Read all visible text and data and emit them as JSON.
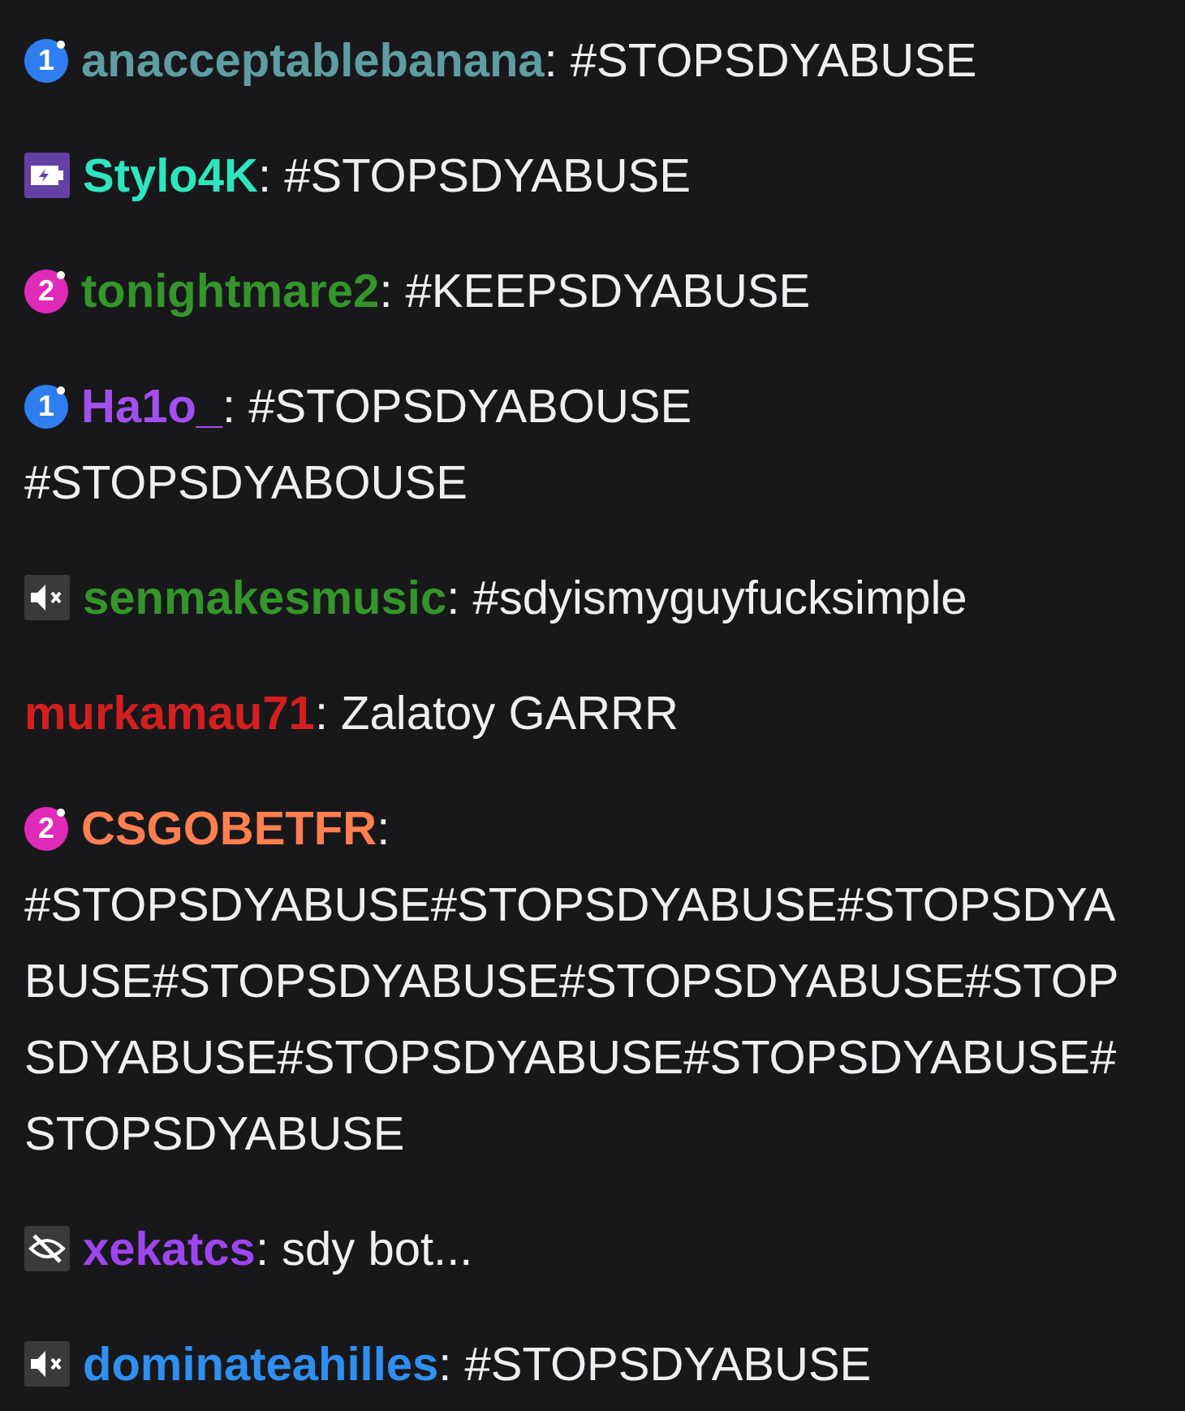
{
  "messages": [
    {
      "badge": {
        "kind": "sub",
        "text": "1",
        "color": "#2f7ef0"
      },
      "user": {
        "name": "anacceptablebanana",
        "color": "#5f9ea0"
      },
      "text": ": #STOPSDYABUSE"
    },
    {
      "badge": {
        "kind": "battery"
      },
      "user": {
        "name": "Stylo4K",
        "color": "#2ee6bd"
      },
      "text": ": #STOPSDYABUSE"
    },
    {
      "badge": {
        "kind": "sub",
        "text": "2",
        "color": "#e02ab8"
      },
      "user": {
        "name": "tonightmare2",
        "color": "#34952a"
      },
      "text": ": #KEEPSDYABUSE"
    },
    {
      "badge": {
        "kind": "sub",
        "text": "1",
        "color": "#2f7ef0"
      },
      "user": {
        "name": "Ha1o_",
        "color": "#a24ff0"
      },
      "text": ": #STOPSDYABOUSE",
      "continuation": [
        "#STOPSDYABOUSE"
      ]
    },
    {
      "badge": {
        "kind": "muted"
      },
      "user": {
        "name": "senmakesmusic",
        "color": "#34952a"
      },
      "text": ": #sdyismyguyfucksimple"
    },
    {
      "user": {
        "name": "murkamau71",
        "color": "#d41f1f"
      },
      "text": ": Zalatoy GARRR"
    },
    {
      "badge": {
        "kind": "sub",
        "text": "2",
        "color": "#e02ab8"
      },
      "user": {
        "name": "CSGOBETFR",
        "color": "#ff7f50"
      },
      "text": ":",
      "continuation": [
        "#STOPSDYABUSE#STOPSDYABUSE#STOPSDYA",
        "BUSE#STOPSDYABUSE#STOPSDYABUSE#STOP",
        "SDYABUSE#STOPSDYABUSE#STOPSDYABUSE#",
        "STOPSDYABUSE"
      ]
    },
    {
      "badge": {
        "kind": "hidden"
      },
      "user": {
        "name": "xekatcs",
        "color": "#9d45ee"
      },
      "text": ": sdy bot..."
    },
    {
      "badge": {
        "kind": "muted"
      },
      "user": {
        "name": "dominateahilles",
        "color": "#2f8ff0"
      },
      "text": ": #STOPSDYABUSE"
    }
  ]
}
